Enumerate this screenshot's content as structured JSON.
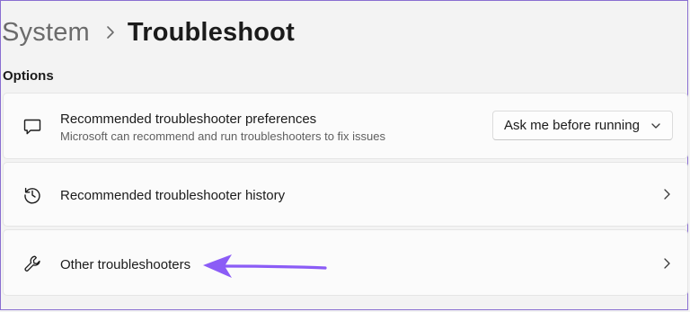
{
  "breadcrumb": {
    "parent": "System",
    "separator": "›",
    "current": "Troubleshoot"
  },
  "section": {
    "label": "Options"
  },
  "items": [
    {
      "title": "Recommended troubleshooter preferences",
      "subtitle": "Microsoft can recommend and run troubleshooters to fix issues",
      "icon": "chat-bubble-icon",
      "control": {
        "type": "dropdown",
        "selected": "Ask me before running"
      }
    },
    {
      "title": "Recommended troubleshooter history",
      "icon": "history-icon",
      "control": {
        "type": "chevron"
      }
    },
    {
      "title": "Other troubleshooters",
      "icon": "wrench-icon",
      "control": {
        "type": "chevron"
      }
    }
  ],
  "annotation": {
    "icon": "purple-arrow",
    "color": "#8b5cf6"
  },
  "colors": {
    "background": "#f3f3f3",
    "card": "#fbfbfb",
    "text": "#1b1b1b",
    "secondary_text": "#5f5f5f",
    "accent_border": "#8a6fd1"
  }
}
